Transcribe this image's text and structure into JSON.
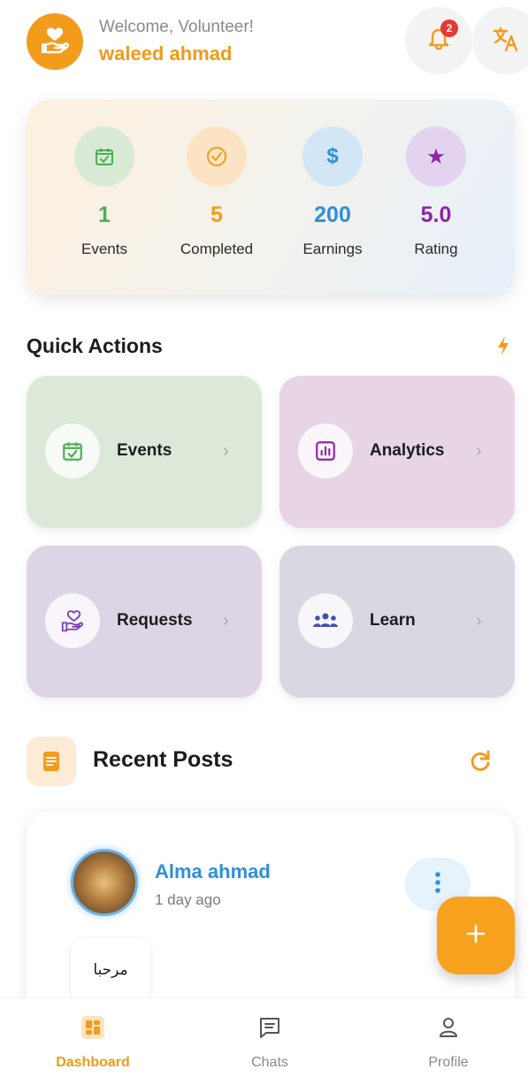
{
  "header": {
    "welcome": "Welcome, Volunteer!",
    "username": "waleed ahmad",
    "notification_count": "2"
  },
  "stats": [
    {
      "value": "1",
      "label": "Events",
      "icon": "calendar-check-icon",
      "color": "#4caf50"
    },
    {
      "value": "5",
      "label": "Completed",
      "icon": "check-circle-icon",
      "color": "#f39c1c"
    },
    {
      "value": "200",
      "label": "Earnings",
      "icon": "dollar-icon",
      "color": "#2e8fdb"
    },
    {
      "value": "5.0",
      "label": "Rating",
      "icon": "star-icon",
      "color": "#8e24aa"
    }
  ],
  "quick_actions": {
    "title": "Quick Actions",
    "items": [
      {
        "label": "Events",
        "icon": "calendar-check-icon"
      },
      {
        "label": "Analytics",
        "icon": "analytics-icon"
      },
      {
        "label": "Requests",
        "icon": "heart-hand-icon"
      },
      {
        "label": "Learn",
        "icon": "people-icon"
      }
    ]
  },
  "recent_posts": {
    "title": "Recent Posts",
    "post": {
      "author": "Alma ahmad",
      "time": "1 day ago",
      "text": "مرحبا"
    }
  },
  "nav": [
    {
      "label": "Dashboard",
      "icon": "dashboard-icon",
      "active": true
    },
    {
      "label": "Chats",
      "icon": "chat-icon",
      "active": false
    },
    {
      "label": "Profile",
      "icon": "profile-icon",
      "active": false
    }
  ],
  "colors": {
    "accent": "#f39c1c",
    "link_blue": "#2e8fdb",
    "purple": "#8e24aa",
    "green": "#4caf50"
  }
}
